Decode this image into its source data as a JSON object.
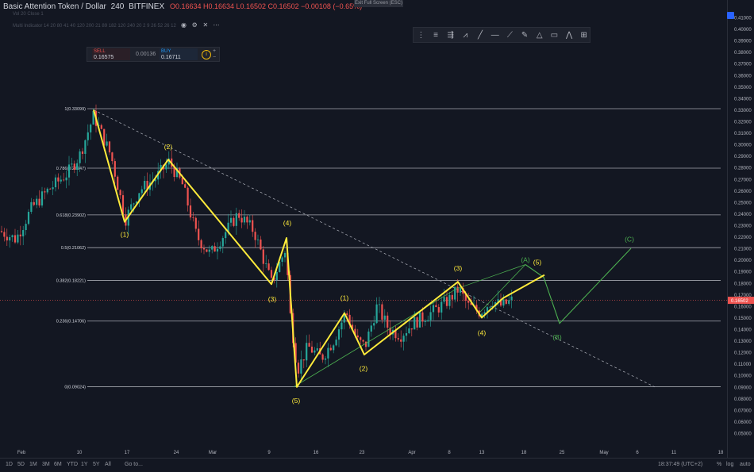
{
  "header": {
    "symbol": "Basic Attention Token / Dollar",
    "interval": "240",
    "exchange": "BITFINEX",
    "ohlc": "O0.16634  H0.16634  L0.16502  C0.16502  −0.00108 (−0.65%)",
    "exit_fullscreen": "Exit Full Screen (ESC)",
    "indicator_1": "Vol 20  Close  1",
    "indicator_2": "Multi Indicator 14 20 80 41 40 120 200 21 89 182 120 240 20 2 9 26 52 26 12"
  },
  "trade": {
    "sell_label": "SELL",
    "sell_value": "0.16575",
    "spread": "0.00136",
    "buy_label": "BUY",
    "buy_value": "0.16711",
    "info": "i"
  },
  "toolbar_icons": [
    "drag-handle-icon",
    "fib-retracement-icon",
    "fib-extension-icon",
    "pattern-icon",
    "trend-line-icon",
    "horizontal-line-icon",
    "ray-icon",
    "brush-icon",
    "triangle-icon",
    "rectangle-icon",
    "elliott-wave-icon",
    "fib-time-zone-icon"
  ],
  "bottom_bar": {
    "ranges": [
      "1D",
      "5D",
      "1M",
      "3M",
      "6M",
      "YTD",
      "1Y",
      "5Y",
      "All"
    ],
    "goto": "Go to...",
    "time": "18:37:49 (UTC+2)",
    "percent": "%",
    "log": "log",
    "auto": "auto"
  },
  "chart_data": {
    "type": "candlestick",
    "ylim": [
      0.04,
      0.41
    ],
    "y_ticks": [
      "0.41000",
      "0.40000",
      "0.39000",
      "0.38000",
      "0.37000",
      "0.36000",
      "0.35000",
      "0.34000",
      "0.33000",
      "0.32000",
      "0.31000",
      "0.30000",
      "0.29000",
      "0.28000",
      "0.27000",
      "0.26000",
      "0.25000",
      "0.24000",
      "0.23000",
      "0.22000",
      "0.21000",
      "0.20000",
      "0.19000",
      "0.18000",
      "0.17000",
      "0.16000",
      "0.15000",
      "0.14000",
      "0.13000",
      "0.12000",
      "0.11000",
      "0.10000",
      "0.09000",
      "0.08000",
      "0.07000",
      "0.06000",
      "0.05000"
    ],
    "x_ticks": [
      "Feb",
      "10",
      "17",
      "24",
      "Mar",
      "9",
      "16",
      "23",
      "Apr",
      "8",
      "13",
      "18",
      "25",
      "May",
      "6",
      "11",
      "18"
    ],
    "last_price": "0.16502",
    "fib_levels": [
      {
        "label": "1(0.33099)",
        "value": 0.33099
      },
      {
        "label": "0.786(0.27947)",
        "value": 0.27947
      },
      {
        "label": "0.618(0.23902)",
        "value": 0.23902
      },
      {
        "label": "0.5(0.21062)",
        "value": 0.21062
      },
      {
        "label": "0.382(0.18221)",
        "value": 0.18221
      },
      {
        "label": "0.236(0.14706)",
        "value": 0.14706
      },
      {
        "label": "0(0.09024)",
        "value": 0.09024
      }
    ],
    "wave_labels_yellow": [
      "(1)",
      "(2)",
      "(3)",
      "(4)",
      "(5)",
      "(1)",
      "(2)",
      "(3)",
      "(4)",
      "(5)"
    ],
    "wave_labels_green": [
      "(A)",
      "(B)",
      "(C)"
    ],
    "colors": {
      "up": "#26a69a",
      "down": "#ef5350",
      "wave": "#ffeb3b",
      "projection": "#4caf50",
      "fib": "#d1d4dc"
    }
  }
}
